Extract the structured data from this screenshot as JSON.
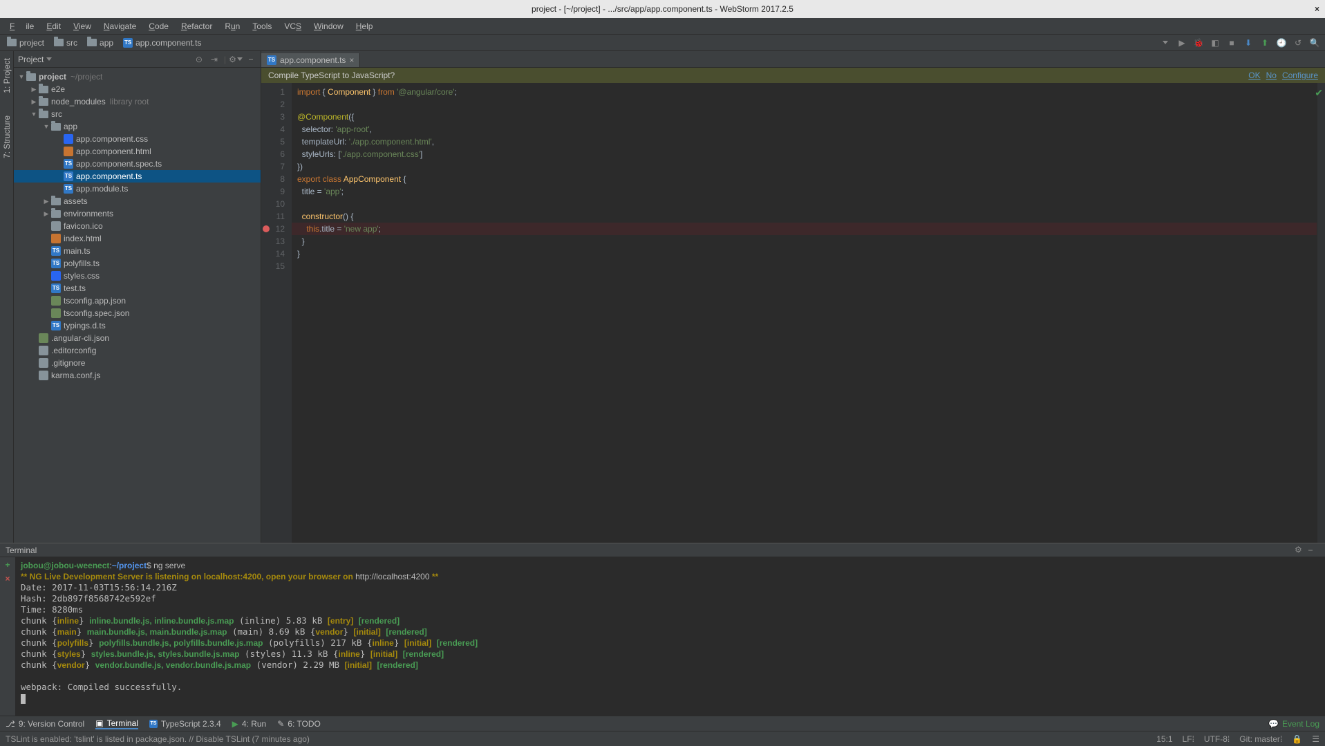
{
  "window": {
    "title": "project - [~/project] - .../src/app/app.component.ts - WebStorm 2017.2.5"
  },
  "menu": {
    "file": "File",
    "edit": "Edit",
    "view": "View",
    "navigate": "Navigate",
    "code": "Code",
    "refactor": "Refactor",
    "run": "Run",
    "tools": "Tools",
    "vcs": "VCS",
    "window": "Window",
    "help": "Help"
  },
  "breadcrumb": {
    "root": "project",
    "src": "src",
    "app": "app",
    "file": "app.component.ts"
  },
  "projectPane": {
    "title": "Project",
    "root": {
      "name": "project",
      "path": "~/project"
    },
    "nodes": [
      {
        "depth": 1,
        "type": "folder",
        "name": "e2e",
        "expanded": false
      },
      {
        "depth": 1,
        "type": "folder",
        "name": "node_modules",
        "hint": "library root",
        "expanded": false
      },
      {
        "depth": 1,
        "type": "folder",
        "name": "src",
        "expanded": true
      },
      {
        "depth": 2,
        "type": "folder",
        "name": "app",
        "expanded": true
      },
      {
        "depth": 3,
        "type": "css",
        "name": "app.component.css"
      },
      {
        "depth": 3,
        "type": "html",
        "name": "app.component.html"
      },
      {
        "depth": 3,
        "type": "ts",
        "name": "app.component.spec.ts"
      },
      {
        "depth": 3,
        "type": "ts",
        "name": "app.component.ts",
        "selected": true
      },
      {
        "depth": 3,
        "type": "ts",
        "name": "app.module.ts"
      },
      {
        "depth": 2,
        "type": "folder",
        "name": "assets",
        "expanded": false
      },
      {
        "depth": 2,
        "type": "folder",
        "name": "environments",
        "expanded": false
      },
      {
        "depth": 2,
        "type": "file",
        "name": "favicon.ico"
      },
      {
        "depth": 2,
        "type": "html",
        "name": "index.html"
      },
      {
        "depth": 2,
        "type": "ts",
        "name": "main.ts"
      },
      {
        "depth": 2,
        "type": "ts",
        "name": "polyfills.ts"
      },
      {
        "depth": 2,
        "type": "css",
        "name": "styles.css"
      },
      {
        "depth": 2,
        "type": "ts",
        "name": "test.ts"
      },
      {
        "depth": 2,
        "type": "json",
        "name": "tsconfig.app.json"
      },
      {
        "depth": 2,
        "type": "json",
        "name": "tsconfig.spec.json"
      },
      {
        "depth": 2,
        "type": "ts",
        "name": "typings.d.ts"
      },
      {
        "depth": 1,
        "type": "json",
        "name": ".angular-cli.json"
      },
      {
        "depth": 1,
        "type": "file",
        "name": ".editorconfig"
      },
      {
        "depth": 1,
        "type": "file",
        "name": ".gitignore"
      },
      {
        "depth": 1,
        "type": "file",
        "name": "karma.conf.js"
      }
    ]
  },
  "leftRail": {
    "project": "1: Project",
    "structure": "7: Structure"
  },
  "editor": {
    "tab": "app.component.ts",
    "banner": {
      "text": "Compile TypeScript to JavaScript?",
      "ok": "OK",
      "no": "No",
      "conf": "Configure"
    },
    "breakpointLine": 12,
    "code": [
      {
        "n": 1,
        "html": "<span class='kw'>import</span> { <span class='id'>Component</span> } <span class='kw'>from</span> <span class='str'>'@angular/core'</span>;"
      },
      {
        "n": 2,
        "html": ""
      },
      {
        "n": 3,
        "html": "<span class='dec'>@Component</span>({"
      },
      {
        "n": 4,
        "html": "  selector: <span class='str'>'app-root'</span>,"
      },
      {
        "n": 5,
        "html": "  templateUrl: <span class='str'>'./app.component.html'</span>,"
      },
      {
        "n": 6,
        "html": "  styleUrls: [<span class='str'>'./app.component.css'</span>]"
      },
      {
        "n": 7,
        "html": "})"
      },
      {
        "n": 8,
        "html": "<span class='kw'>export</span> <span class='kw'>class</span> <span class='id'>AppComponent</span> {"
      },
      {
        "n": 9,
        "html": "  title = <span class='str'>'app'</span>;"
      },
      {
        "n": 10,
        "html": ""
      },
      {
        "n": 11,
        "html": "  <span class='id'>constructor</span>() {"
      },
      {
        "n": 12,
        "html": "    <span class='this'>this</span>.title = <span class='str'>'new app'</span>;"
      },
      {
        "n": 13,
        "html": "  }"
      },
      {
        "n": 14,
        "html": "}"
      },
      {
        "n": 15,
        "html": ""
      }
    ]
  },
  "terminal": {
    "title": "Terminal",
    "lines": [
      "<span class='t-gr'>jobou@jobou-weenect</span><span class='t-w'>:</span><span class='t-b'>~/project</span><span class='t-w'>$ ng serve</span>",
      "<span class='t-y'>** NG Live Development Server is listening on localhost:4200, open your browser on </span><span class='t-w'>http://localhost:4200</span><span class='t-y'> **</span>",
      "Date: 2017-11-03T15:56:14.216Z",
      "Hash: 2db897f8568742e592ef",
      "Time: 8280ms",
      "chunk {<span class='t-y'>inline</span>} <span class='t-gr'>inline.bundle.js, inline.bundle.js.map</span> (inline) 5.83 kB <span class='t-y'>[entry]</span> <span class='t-gr'>[rendered]</span>",
      "chunk {<span class='t-y'>main</span>} <span class='t-gr'>main.bundle.js, main.bundle.js.map</span> (main) 8.69 kB {<span class='t-y'>vendor</span>} <span class='t-y'>[initial]</span> <span class='t-gr'>[rendered]</span>",
      "chunk {<span class='t-y'>polyfills</span>} <span class='t-gr'>polyfills.bundle.js, polyfills.bundle.js.map</span> (polyfills) 217 kB {<span class='t-y'>inline</span>} <span class='t-y'>[initial]</span> <span class='t-gr'>[rendered]</span>",
      "chunk {<span class='t-y'>styles</span>} <span class='t-gr'>styles.bundle.js, styles.bundle.js.map</span> (styles) 11.3 kB {<span class='t-y'>inline</span>} <span class='t-y'>[initial]</span> <span class='t-gr'>[rendered]</span>",
      "chunk {<span class='t-y'>vendor</span>} <span class='t-gr'>vendor.bundle.js, vendor.bundle.js.map</span> (vendor) 2.29 MB <span class='t-y'>[initial]</span> <span class='t-gr'>[rendered]</span>",
      "",
      "webpack: Compiled successfully."
    ]
  },
  "bottomTools": {
    "vcs": "9: Version Control",
    "terminal": "Terminal",
    "typescript": "TypeScript 2.3.4",
    "run": "4: Run",
    "todo": "6: TODO",
    "eventlog": "Event Log"
  },
  "status": {
    "msg": "TSLint is enabled: 'tslint' is listed in package.json. // Disable TSLint (7 minutes ago)",
    "pos": "15:1",
    "le": "LF",
    "enc": "UTF-8",
    "git": "Git: master"
  }
}
